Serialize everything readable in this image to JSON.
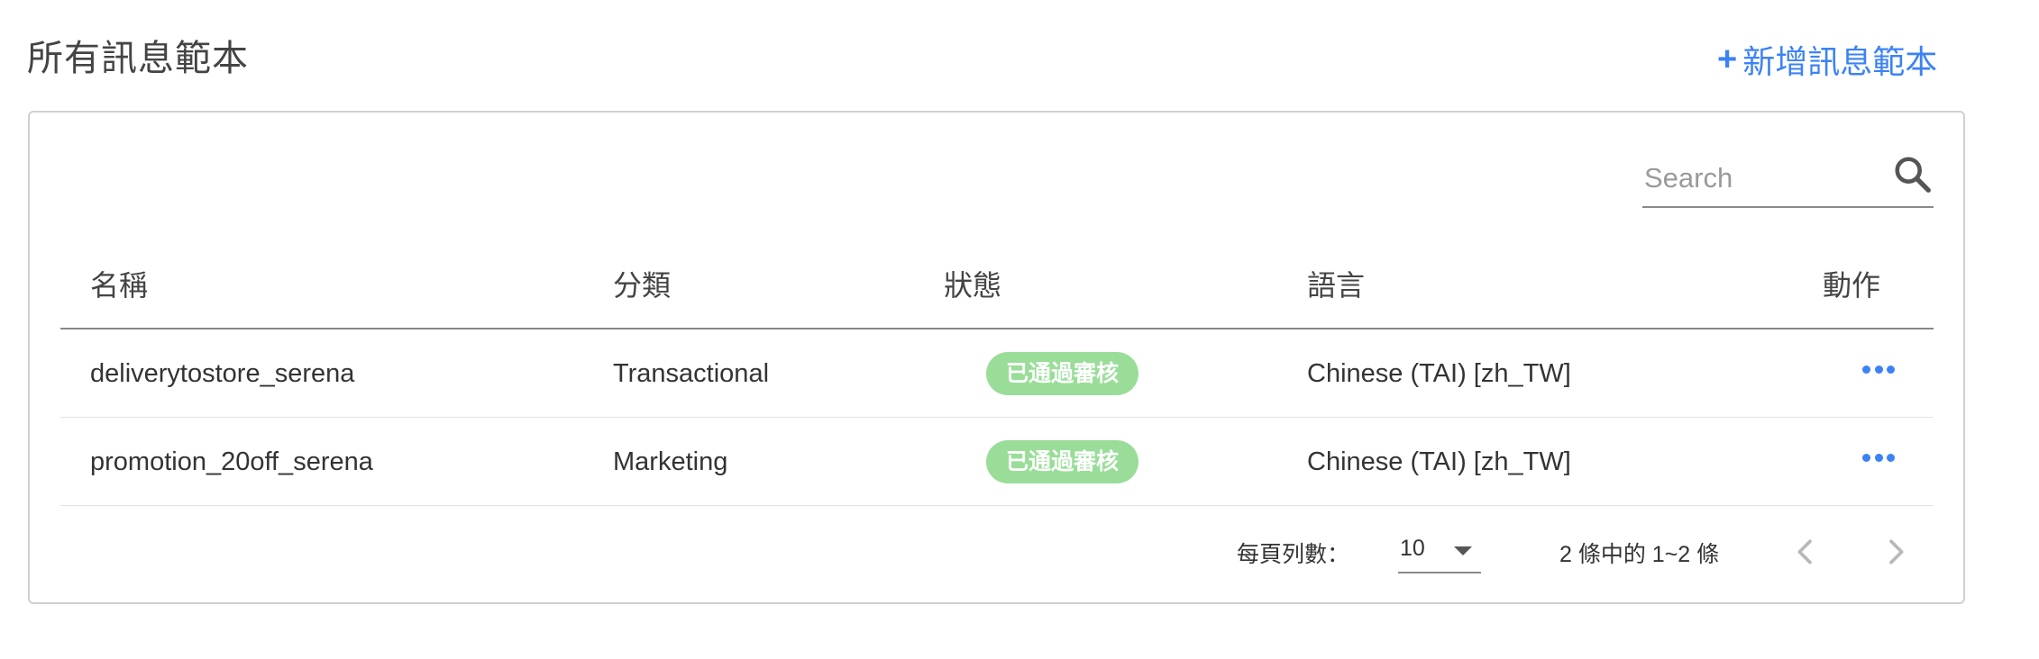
{
  "page": {
    "title": "所有訊息範本",
    "add_label": "新增訊息範本",
    "add_plus": "+"
  },
  "search": {
    "placeholder": "Search"
  },
  "table": {
    "headers": {
      "name": "名稱",
      "category": "分類",
      "status": "狀態",
      "language": "語言",
      "actions": "動作"
    },
    "rows": [
      {
        "name": "deliverytostore_serena",
        "category": "Transactional",
        "status": "已通過審核",
        "language": "Chinese (TAI) [zh_TW]"
      },
      {
        "name": "promotion_20off_serena",
        "category": "Marketing",
        "status": "已通過審核",
        "language": "Chinese (TAI) [zh_TW]"
      }
    ]
  },
  "pagination": {
    "rows_per_page_label": "每頁列數：",
    "rows_per_page_value": "10",
    "range_text": "2 條中的 1~2 條"
  },
  "colors": {
    "accent": "#3c82f6",
    "badge_approved": "#99dd99"
  },
  "icons": {
    "search": "search-icon",
    "more": "more-horizontal-icon",
    "prev": "chevron-left-icon",
    "next": "chevron-right-icon",
    "dropdown": "caret-down-icon"
  }
}
